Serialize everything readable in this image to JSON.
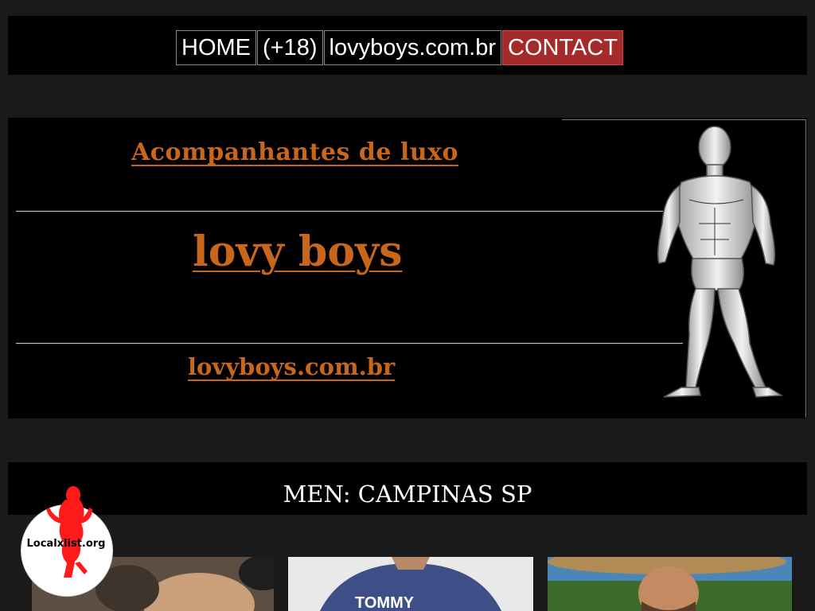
{
  "nav": {
    "home": "HOME",
    "adult": "(+18)",
    "domain": "lovyboys.com.br",
    "contact": "CONTACT"
  },
  "banner": {
    "line1": "Acompanhantes de luxo",
    "line2": "lovy boys",
    "line3": "lovyboys.com.br"
  },
  "section": {
    "title": "MEN: CAMPINAS SP"
  },
  "thumbnails": {
    "shirt_text": "TOMMY"
  },
  "watermark": {
    "text": "Localxlist.org"
  },
  "colors": {
    "page_bg": "#1a1a1a",
    "bar_bg": "#000000",
    "accent_orange": "#c8661b",
    "contact_red": "#a52a2a"
  }
}
